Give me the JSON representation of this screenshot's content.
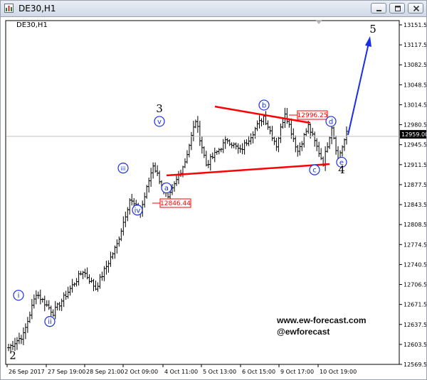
{
  "window": {
    "title": "DE30,H1",
    "inner_title": "DE30,H1",
    "buttons": [
      "minimize",
      "restore",
      "close"
    ]
  },
  "branding": {
    "site": "www.ew-forecast.com",
    "handle": "@ewforecast"
  },
  "colors": {
    "bars": "#000000",
    "trendline": "#ff0000",
    "wave_label": "#1a2eea",
    "projection": "#1a2eea",
    "price_box": "#ff0000",
    "current_price_line": "#c0c0c0"
  },
  "chart_data": {
    "type": "ohlc",
    "symbol": "DE30",
    "timeframe": "H1",
    "y_ticks": [
      "13151.50",
      "13117.50",
      "13082.50",
      "13048.50",
      "13014.50",
      "12980.50",
      "12945.50",
      "12911.50",
      "12877.50",
      "12843.50",
      "12808.50",
      "12774.50",
      "12740.50",
      "12706.50",
      "12671.50",
      "12637.50",
      "12603.50",
      "12569.50"
    ],
    "x_ticks": [
      "26 Sep 2017",
      "27 Sep 19:00",
      "28 Sep 21:00",
      "2 Oct 09:00",
      "4 Oct 11:00",
      "5 Oct 13:00",
      "6 Oct 15:00",
      "9 Oct 17:00",
      "10 Oct 19:00"
    ],
    "current_price": "12959.00",
    "price_labels": [
      {
        "value": "12996.25"
      },
      {
        "value": "12846.44"
      }
    ],
    "wave_labels": [
      {
        "text": "2",
        "style": "plain",
        "price": 12585
      },
      {
        "text": "i",
        "style": "circled-roman",
        "price": 12688
      },
      {
        "text": "ii",
        "style": "circled-roman",
        "price": 12643
      },
      {
        "text": "iii",
        "style": "circled-roman",
        "price": 12906
      },
      {
        "text": "iv",
        "style": "circled-roman",
        "price": 12834
      },
      {
        "text": "v",
        "style": "circled-roman",
        "price": 12986
      },
      {
        "text": "3",
        "style": "plain",
        "price": 13008
      },
      {
        "text": "a",
        "style": "circled",
        "price": 12872
      },
      {
        "text": "b",
        "style": "circled",
        "price": 13014
      },
      {
        "text": "c",
        "style": "circled",
        "price": 12903
      },
      {
        "text": "d",
        "style": "circled",
        "price": 12986
      },
      {
        "text": "e",
        "style": "circled",
        "price": 12916
      },
      {
        "text": "4",
        "style": "plain",
        "price": 12903
      },
      {
        "text": "5",
        "style": "plain",
        "price": 13144
      }
    ],
    "segments": [
      [
        12595,
        12620,
        8
      ],
      [
        12620,
        12692,
        6
      ],
      [
        12692,
        12658,
        8
      ],
      [
        12658,
        12730,
        14
      ],
      [
        12730,
        12700,
        6
      ],
      [
        12700,
        12775,
        10
      ],
      [
        12775,
        12852,
        6
      ],
      [
        12852,
        12830,
        5
      ],
      [
        12830,
        12912,
        6
      ],
      [
        12912,
        12852,
        7
      ],
      [
        12852,
        12918,
        8
      ],
      [
        12918,
        12988,
        5
      ],
      [
        12988,
        12912,
        5
      ],
      [
        12912,
        12955,
        10
      ],
      [
        12955,
        12935,
        6
      ],
      [
        12935,
        12995,
        11
      ],
      [
        12995,
        12945,
        6
      ],
      [
        12945,
        13002,
        4
      ],
      [
        13002,
        12935,
        6
      ],
      [
        12935,
        12978,
        5
      ],
      [
        12978,
        12915,
        7
      ],
      [
        12915,
        12978,
        4
      ],
      [
        12978,
        12922,
        3
      ],
      [
        12922,
        12965,
        4
      ]
    ]
  }
}
